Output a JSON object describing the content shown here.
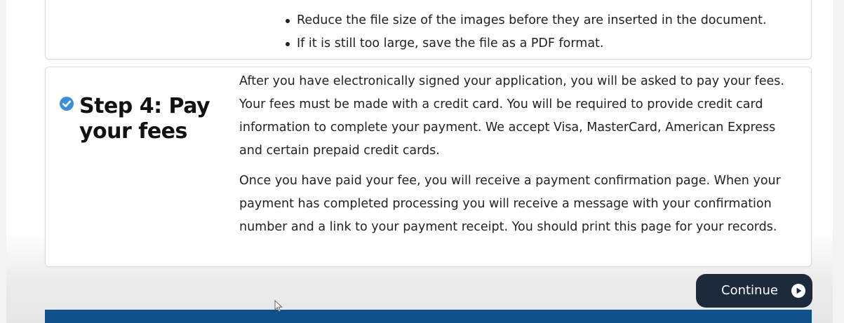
{
  "top_card": {
    "bullets": [
      "Reduce the file size of the images before they are inserted in the document.",
      "If it is still too large, save the file as a PDF format."
    ]
  },
  "step4": {
    "title": "Step 4: Pay your fees",
    "status_icon": "check-circle-icon",
    "paragraphs": [
      "After you have electronically signed your application, you will be asked to pay your fees. Your fees must be made with a credit card. You will be required to provide credit card information to complete your payment. We accept Visa, MasterCard, American Express and certain prepaid credit cards.",
      "Once you have paid your fee, you will receive a payment confirmation page.  When your payment has completed processing  you will receive a message with your confirmation number and a link to your payment receipt.  You should print this page for your records."
    ]
  },
  "continue_button": {
    "label": "Continue",
    "icon": "play-circle-icon"
  },
  "colors": {
    "check_icon": "#3a8fd6",
    "button_bg": "#1d2a3b",
    "footer_bar": "#0f4f8a"
  }
}
